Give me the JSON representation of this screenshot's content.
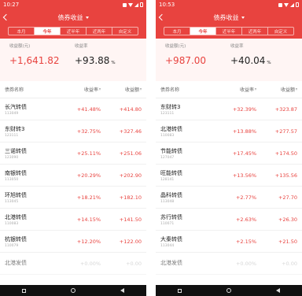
{
  "screens": [
    {
      "status_time": "10:27",
      "title": "债券收益",
      "tabs": [
        "本月",
        "今年",
        "近半年",
        "近两年",
        "自定义"
      ],
      "active_tab": 1,
      "summary": {
        "profit_label": "收益额(元)",
        "profit_value": "+1,641.82",
        "rate_label": "收益率",
        "rate_value": "+93.88",
        "rate_unit": "%"
      },
      "columns": {
        "name": "债券名称",
        "rate": "收益率",
        "income": "收益额"
      },
      "rows": [
        {
          "name": "长汽转债",
          "code": "113049",
          "rate": "+41.48%",
          "income": "+414.80"
        },
        {
          "name": "东财转3",
          "code": "123111",
          "rate": "+32.75%",
          "income": "+327.46"
        },
        {
          "name": "三诺转债",
          "code": "123090",
          "rate": "+25.11%",
          "income": "+251.06"
        },
        {
          "name": "南银转债",
          "code": "113050",
          "rate": "+20.29%",
          "income": "+202.90"
        },
        {
          "name": "环旭转债",
          "code": "113045",
          "rate": "+18.21%",
          "income": "+182.10"
        },
        {
          "name": "北港转债",
          "code": "110083",
          "rate": "+14.15%",
          "income": "+141.50"
        },
        {
          "name": "杭银转债",
          "code": "110079",
          "rate": "+12.20%",
          "income": "+122.00"
        },
        {
          "name": "北港发债",
          "code": "",
          "rate": "+0.00%",
          "income": "+0.00"
        }
      ]
    },
    {
      "status_time": "10:53",
      "title": "债券收益",
      "tabs": [
        "本月",
        "今年",
        "近半年",
        "近两年",
        "自定义"
      ],
      "active_tab": 1,
      "summary": {
        "profit_label": "收益额(元)",
        "profit_value": "+987.00",
        "rate_label": "收益率",
        "rate_value": "+40.04",
        "rate_unit": "%"
      },
      "columns": {
        "name": "债券名称",
        "rate": "收益率",
        "income": "收益额"
      },
      "rows": [
        {
          "name": "东财转3",
          "code": "123111",
          "rate": "+32.39%",
          "income": "+323.87"
        },
        {
          "name": "北港转债",
          "code": "110083",
          "rate": "+13.88%",
          "income": "+277.57"
        },
        {
          "name": "节能转债",
          "code": "127047",
          "rate": "+17.45%",
          "income": "+174.50"
        },
        {
          "name": "旺能转债",
          "code": "128141",
          "rate": "+13.56%",
          "income": "+135.56"
        },
        {
          "name": "晶科转债",
          "code": "113048",
          "rate": "+2.77%",
          "income": "+27.70"
        },
        {
          "name": "苏行转债",
          "code": "110071",
          "rate": "+2.63%",
          "income": "+26.30"
        },
        {
          "name": "大秦转债",
          "code": "113044",
          "rate": "+2.15%",
          "income": "+21.50"
        },
        {
          "name": "北港发债",
          "code": "",
          "rate": "+0.00%",
          "income": "+0.00"
        }
      ]
    }
  ]
}
